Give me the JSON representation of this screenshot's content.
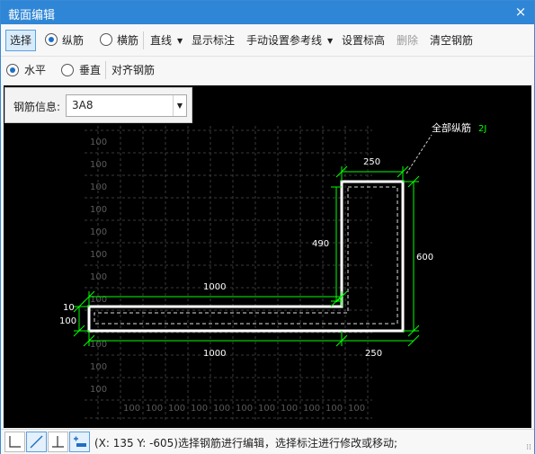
{
  "window": {
    "title": "截面编辑",
    "close_label": "×"
  },
  "toolbar": {
    "select": "选择",
    "longitudinal": "纵筋",
    "transverse": "横筋",
    "line": "直线",
    "show_dims": "显示标注",
    "manual_ref": "手动设置参考线",
    "set_elevation": "设置标高",
    "delete": "删除",
    "clear": "清空钢筋"
  },
  "toolbar2": {
    "horizontal": "水平",
    "vertical": "垂直",
    "align": "对齐钢筋"
  },
  "rebar_info": {
    "label": "钢筋信息:",
    "value": "3A8"
  },
  "drawing": {
    "callout_label": "全部纵筋",
    "callout_tag": "2J",
    "grid_label": "100",
    "dim_top": "250",
    "dim_right": "600",
    "dim_inner_vertical": "490",
    "dim_horizontal_top": "1000",
    "dim_horizontal_bottom": "1000",
    "dim_bottom_right": "250",
    "dim_left_small": "10",
    "dim_left": "100",
    "colors": {
      "dimension": "#00ff00",
      "grid": "#3a3a3a",
      "shape": "#ffffff",
      "text": "#ffffff"
    }
  },
  "status": {
    "text": "(X: 135 Y: -605)选择钢筋进行编辑，选择标注进行修改或移动;"
  },
  "status_buttons": [
    "axis-icon",
    "diagonal-line-icon",
    "perpendicular-icon",
    "add-dimension-icon"
  ]
}
